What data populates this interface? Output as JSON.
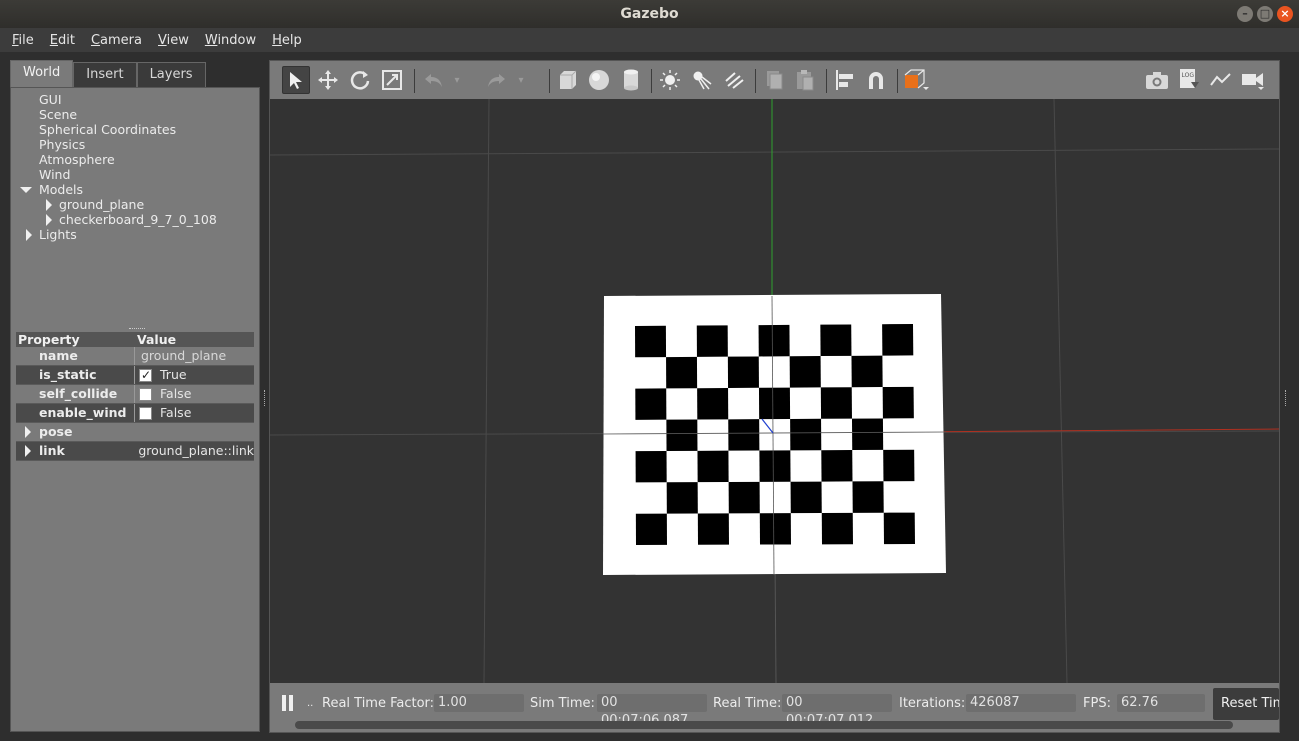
{
  "window": {
    "title": "Gazebo"
  },
  "window_controls": {
    "minimize": "–",
    "maximize": "□",
    "close": "×"
  },
  "menubar": [
    {
      "label": "File",
      "mnemonic": "F",
      "rest": "ile"
    },
    {
      "label": "Edit",
      "mnemonic": "E",
      "rest": "dit"
    },
    {
      "label": "Camera",
      "mnemonic": "C",
      "rest": "amera"
    },
    {
      "label": "View",
      "mnemonic": "V",
      "rest": "iew"
    },
    {
      "label": "Window",
      "mnemonic": "W",
      "rest": "indow"
    },
    {
      "label": "Help",
      "mnemonic": "H",
      "rest": "elp"
    }
  ],
  "left_panel": {
    "tabs": [
      "World",
      "Insert",
      "Layers"
    ],
    "active_tab": "World",
    "tree": {
      "items": [
        "GUI",
        "Scene",
        "Spherical Coordinates",
        "Physics",
        "Atmosphere",
        "Wind"
      ],
      "models_label": "Models",
      "models": [
        "ground_plane",
        "checkerboard_9_7_0_108"
      ],
      "lights_label": "Lights"
    },
    "properties": {
      "header": {
        "property": "Property",
        "value": "Value"
      },
      "rows": [
        {
          "name": "name",
          "value": "ground_plane",
          "kind": "text"
        },
        {
          "name": "is_static",
          "value": "True",
          "kind": "checkbox",
          "checked": true
        },
        {
          "name": "self_collide",
          "value": "False",
          "kind": "checkbox",
          "checked": false
        },
        {
          "name": "enable_wind",
          "value": "False",
          "kind": "checkbox",
          "checked": false
        },
        {
          "name": "pose",
          "value": "",
          "kind": "expand"
        },
        {
          "name": "link",
          "value": "ground_plane::link",
          "kind": "expand"
        }
      ]
    }
  },
  "toolbar": {
    "tools": [
      "select-mode",
      "translate-mode",
      "rotate-mode",
      "scale-mode",
      "undo",
      "undo-history",
      "redo",
      "redo-history",
      "box",
      "sphere",
      "cylinder",
      "point-light",
      "spot-light",
      "directional-light",
      "copy",
      "paste",
      "align",
      "snap",
      "view-angle",
      "screenshot",
      "log",
      "plot",
      "record-video"
    ]
  },
  "statusbar": {
    "step_label": "..",
    "real_time_factor_label": "Real Time Factor:",
    "real_time_factor": "1.00",
    "sim_time_label": "Sim Time:",
    "sim_time": "00 00:07:06.087",
    "real_time_label": "Real Time:",
    "real_time": "00 00:07:07.012",
    "iterations_label": "Iterations:",
    "iterations": "426087",
    "fps_label": "FPS:",
    "fps": "62.76",
    "reset_label": "Reset Time"
  },
  "scene": {
    "checkerboard": {
      "rows": 7,
      "cols": 9
    },
    "colors": {
      "background": "#333333",
      "grid": "#4a4a4a",
      "x_axis": "#b03020",
      "y_axis": "#2fa02f",
      "z_axis": "#2040d0"
    }
  }
}
